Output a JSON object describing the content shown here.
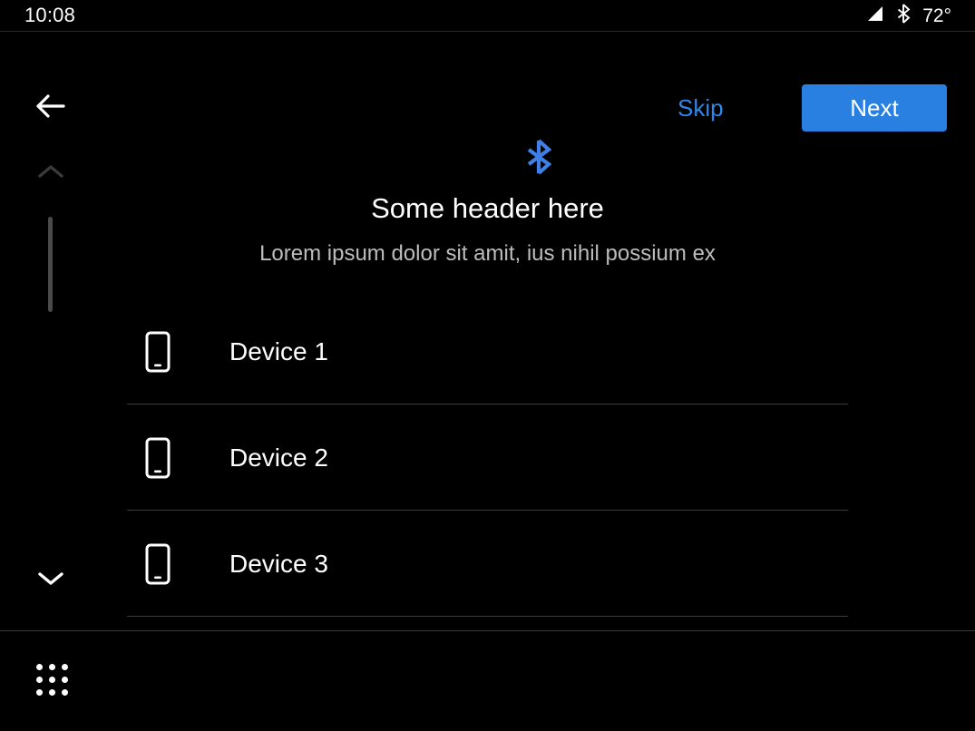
{
  "status_bar": {
    "clock": "10:08",
    "temperature": "72°",
    "signal_icon": "cellular-signal-icon",
    "bluetooth_icon": "bluetooth-status-icon"
  },
  "top_bar": {
    "back_icon": "back-arrow-icon",
    "skip_label": "Skip",
    "next_label": "Next",
    "skip_color": "#2f86e8",
    "next_bg_color": "#2a80e0",
    "next_text_color": "#ffffff"
  },
  "scroll_rail": {
    "up_icon": "chevron-up-icon",
    "down_icon": "chevron-down-icon",
    "up_color": "#3a3a3a",
    "down_color": "#ffffff",
    "thumb_color": "#4a4a4a"
  },
  "content": {
    "hero_icon": "bluetooth-icon",
    "hero_icon_color": "#3f7fe8",
    "header": "Some header here",
    "subheader": "Lorem ipsum dolor sit amit, ius nihil possium ex"
  },
  "devices": [
    {
      "icon": "smartphone-icon",
      "label": "Device 1"
    },
    {
      "icon": "smartphone-icon",
      "label": "Device 2"
    },
    {
      "icon": "smartphone-icon",
      "label": "Device 3"
    }
  ],
  "bottom_bar": {
    "app_drawer_icon": "apps-grid-icon"
  },
  "theme": {
    "background": "#000000",
    "text_primary": "#ffffff",
    "text_secondary": "#bdbdbd",
    "divider": "#3c3c3c"
  }
}
